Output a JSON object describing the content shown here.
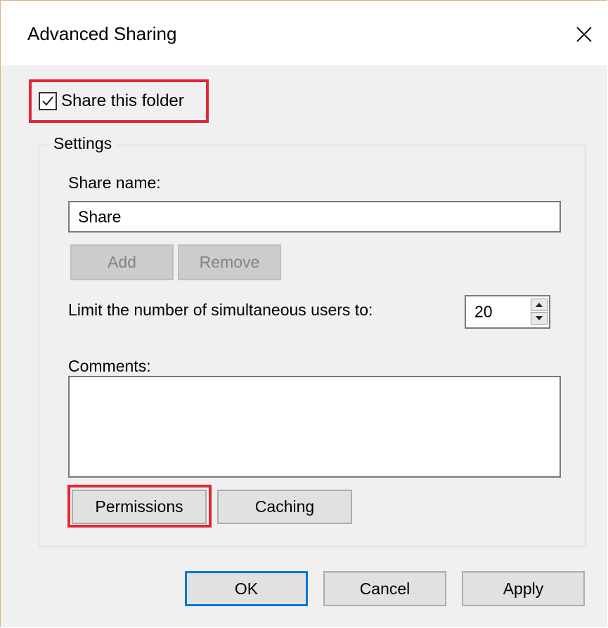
{
  "window": {
    "title": "Advanced Sharing",
    "close_icon": "close-icon"
  },
  "share": {
    "checkbox_label": "Share this folder",
    "checked": true
  },
  "settings": {
    "group_label": "Settings",
    "share_name_label": "Share name:",
    "share_name_value": "Share",
    "add_label": "Add",
    "remove_label": "Remove",
    "limit_label": "Limit the number of simultaneous users to:",
    "limit_value": "20",
    "comments_label": "Comments:",
    "comments_value": "",
    "permissions_label": "Permissions",
    "caching_label": "Caching"
  },
  "footer": {
    "ok_label": "OK",
    "cancel_label": "Cancel",
    "apply_label": "Apply"
  },
  "colors": {
    "highlight": "#e32636",
    "default_button_border": "#0078d7"
  }
}
